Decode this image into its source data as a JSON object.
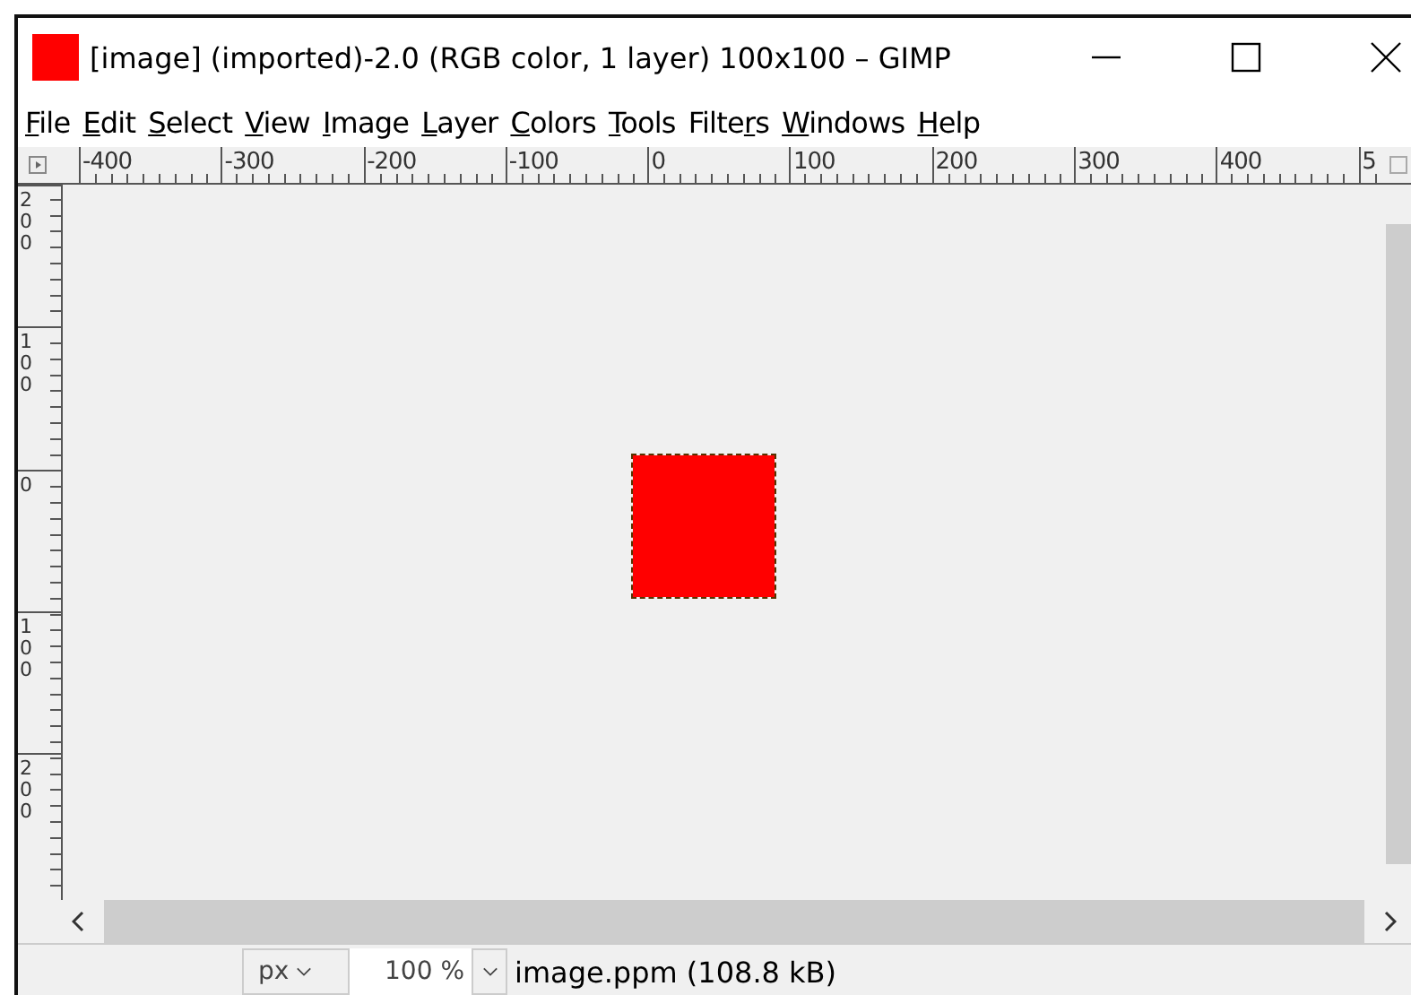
{
  "window": {
    "title": "[image] (imported)-2.0 (RGB color, 1 layer) 100x100 – GIMP"
  },
  "menu": [
    {
      "key": "F",
      "after": "ile"
    },
    {
      "key": "E",
      "after": "dit"
    },
    {
      "key": "S",
      "after": "elect"
    },
    {
      "key": "V",
      "after": "iew"
    },
    {
      "key": "I",
      "after": "mage"
    },
    {
      "key": "L",
      "after": "ayer"
    },
    {
      "key": "C",
      "after": "olors"
    },
    {
      "key": "T",
      "after": "ools"
    },
    {
      "before": "Filte",
      "key": "r",
      "after": "s"
    },
    {
      "key": "W",
      "after": "indows"
    },
    {
      "key": "H",
      "after": "elp"
    }
  ],
  "top_ruler": [
    "-400",
    "-300",
    "-200",
    "-100",
    "0",
    "100",
    "200",
    "300",
    "400",
    "5"
  ],
  "left_ruler": [
    "200",
    "100",
    "0",
    "100",
    "200"
  ],
  "status_bar": {
    "unit": "px",
    "zoom": "100 %",
    "file_info": "image.ppm (108.8 kB)"
  }
}
